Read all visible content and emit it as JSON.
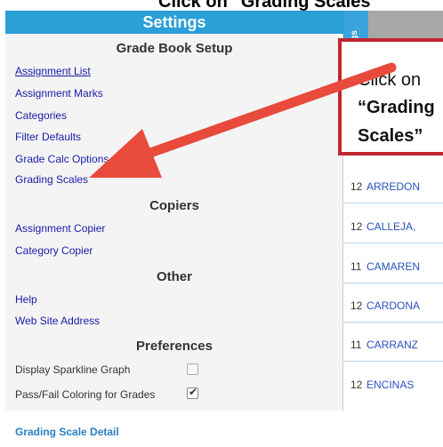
{
  "top_caption": "Click on \"Grading Scales\"",
  "panel": {
    "title": "Settings",
    "gradebook_setup": {
      "title": "Grade Book Setup",
      "links": [
        "Assignment List",
        "Assignment Marks",
        "Categories",
        "Filter Defaults",
        "Grade Calc Options",
        "Grading Scales"
      ]
    },
    "copiers": {
      "title": "Copiers",
      "links": [
        "Assignment Copier",
        "Category Copier"
      ]
    },
    "other": {
      "title": "Other",
      "links": [
        "Help",
        "Web Site Address"
      ]
    },
    "preferences": {
      "title": "Preferences",
      "items": [
        {
          "label": "Display Sparkline Graph",
          "checked": false
        },
        {
          "label": "Pass/Fail Coloring for Grades",
          "checked": true
        }
      ]
    }
  },
  "side_tab_label": "ngs",
  "students": [
    {
      "grade": "12",
      "name": "ARREDON"
    },
    {
      "grade": "12",
      "name": "CALLEJA,"
    },
    {
      "grade": "11",
      "name": "CAMAREN"
    },
    {
      "grade": "12",
      "name": "CARDONA"
    },
    {
      "grade": "11",
      "name": "CARRANZ"
    },
    {
      "grade": "12",
      "name": "ENCINAS"
    }
  ],
  "callout": {
    "line1": "Click on",
    "line2": "“Grading",
    "line3": "Scales”"
  },
  "bottom_label": "Grading Scale Detail",
  "colors": {
    "header_blue": "#2a9fd8",
    "link_blue": "#1a1aa8",
    "callout_red": "#c0272d",
    "arrow_red": "#e84a3b"
  }
}
